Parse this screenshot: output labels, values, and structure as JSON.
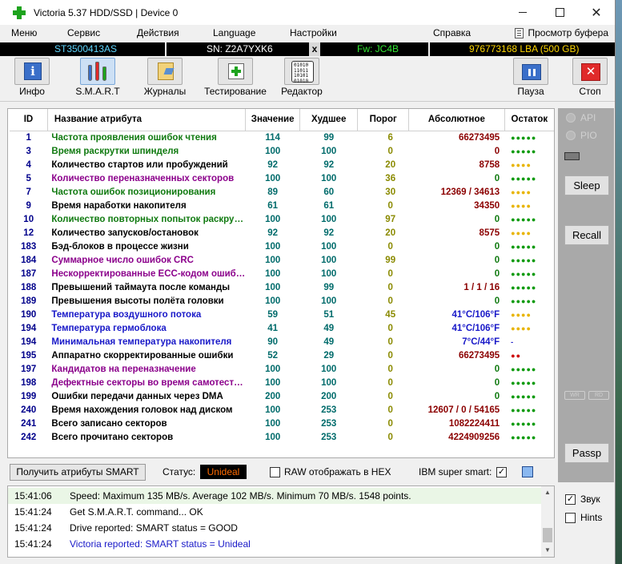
{
  "window": {
    "title": "Victoria 5.37 HDD/SSD | Device 0",
    "close_glyph": "✕"
  },
  "menu": {
    "items": [
      "Меню",
      "Сервис",
      "Действия",
      "Language",
      "Настройки",
      "Справка"
    ],
    "buffer_view": "Просмотр буфера"
  },
  "infobar": {
    "model": "ST3500413AS",
    "serial": "SN: Z2A7YXK6",
    "close_x": "x",
    "firmware": "Fw: JC4B",
    "capacity": "976773168 LBA (500 GB)"
  },
  "toolbar": {
    "info": "Инфо",
    "smart": "S.M.A.R.T",
    "logs": "Журналы",
    "testing": "Тестирование",
    "editor": "Редактор",
    "pause": "Пауза",
    "stop": "Стоп",
    "info_glyph": "i",
    "stop_glyph": "✕",
    "editor_glyph": "01010 11011 10101 01010"
  },
  "table": {
    "headers": {
      "id": "ID",
      "name": "Название атрибута",
      "value": "Значение",
      "worst": "Худшее",
      "threshold": "Порог",
      "absolute": "Абсолютное",
      "remaining": "Остаток"
    },
    "rows": [
      {
        "id": "1",
        "name": "Частота проявления ошибок чтения",
        "value": "114",
        "worst": "99",
        "threshold": "6",
        "absolute": "66273495",
        "remaining": "●●●●●",
        "name_color": "green",
        "rem_color": "green",
        "abs_color": "red"
      },
      {
        "id": "3",
        "name": "Время раскрутки шпинделя",
        "value": "100",
        "worst": "100",
        "threshold": "0",
        "absolute": "0",
        "remaining": "●●●●●",
        "name_color": "green",
        "rem_color": "green",
        "abs_color": "red"
      },
      {
        "id": "4",
        "name": "Количество стартов или пробуждений",
        "value": "92",
        "worst": "92",
        "threshold": "20",
        "absolute": "8758",
        "remaining": "●●●●",
        "name_color": "black",
        "rem_color": "yellow",
        "abs_color": "red"
      },
      {
        "id": "5",
        "name": "Количество переназначенных секторов",
        "value": "100",
        "worst": "100",
        "threshold": "36",
        "absolute": "0",
        "remaining": "●●●●●",
        "name_color": "purple",
        "rem_color": "green",
        "abs_color": "green"
      },
      {
        "id": "7",
        "name": "Частота ошибок позиционирования",
        "value": "89",
        "worst": "60",
        "threshold": "30",
        "absolute": "12369 / 34613",
        "remaining": "●●●●",
        "name_color": "green",
        "rem_color": "yellow",
        "abs_color": "red"
      },
      {
        "id": "9",
        "name": "Время наработки накопителя",
        "value": "61",
        "worst": "61",
        "threshold": "0",
        "absolute": "34350",
        "remaining": "●●●●",
        "name_color": "black",
        "rem_color": "yellow",
        "abs_color": "red"
      },
      {
        "id": "10",
        "name": "Количество повторных попыток раскрутки",
        "value": "100",
        "worst": "100",
        "threshold": "97",
        "absolute": "0",
        "remaining": "●●●●●",
        "name_color": "green",
        "rem_color": "green",
        "abs_color": "green"
      },
      {
        "id": "12",
        "name": "Количество запусков/остановок",
        "value": "92",
        "worst": "92",
        "threshold": "20",
        "absolute": "8575",
        "remaining": "●●●●",
        "name_color": "black",
        "rem_color": "yellow",
        "abs_color": "red"
      },
      {
        "id": "183",
        "name": "Бэд-блоков в процессе жизни",
        "value": "100",
        "worst": "100",
        "threshold": "0",
        "absolute": "0",
        "remaining": "●●●●●",
        "name_color": "black",
        "rem_color": "green",
        "abs_color": "green"
      },
      {
        "id": "184",
        "name": "Суммарное число ошибок CRC",
        "value": "100",
        "worst": "100",
        "threshold": "99",
        "absolute": "0",
        "remaining": "●●●●●",
        "name_color": "purple",
        "rem_color": "green",
        "abs_color": "green"
      },
      {
        "id": "187",
        "name": "Нескорректированные ECC-кодом ошибки",
        "value": "100",
        "worst": "100",
        "threshold": "0",
        "absolute": "0",
        "remaining": "●●●●●",
        "name_color": "purple",
        "rem_color": "green",
        "abs_color": "green"
      },
      {
        "id": "188",
        "name": "Превышений таймаута после команды",
        "value": "100",
        "worst": "99",
        "threshold": "0",
        "absolute": "1 / 1 / 16",
        "remaining": "●●●●●",
        "name_color": "black",
        "rem_color": "green",
        "abs_color": "red"
      },
      {
        "id": "189",
        "name": "Превышения высоты полёта головки",
        "value": "100",
        "worst": "100",
        "threshold": "0",
        "absolute": "0",
        "remaining": "●●●●●",
        "name_color": "black",
        "rem_color": "green",
        "abs_color": "green"
      },
      {
        "id": "190",
        "name": "Температура воздушного потока",
        "value": "59",
        "worst": "51",
        "threshold": "45",
        "absolute": "41°C/106°F",
        "remaining": "●●●●",
        "name_color": "blue",
        "rem_color": "yellow",
        "abs_color": "blue"
      },
      {
        "id": "194",
        "name": "Температура гермоблока",
        "value": "41",
        "worst": "49",
        "threshold": "0",
        "absolute": "41°C/106°F",
        "remaining": "●●●●",
        "name_color": "blue",
        "rem_color": "yellow",
        "abs_color": "blue"
      },
      {
        "id": "194",
        "name": "Минимальная температура накопителя",
        "value": "90",
        "worst": "49",
        "threshold": "0",
        "absolute": "7°C/44°F",
        "remaining": "-",
        "name_color": "blue",
        "rem_color": "blue",
        "abs_color": "blue"
      },
      {
        "id": "195",
        "name": "Аппаратно скорректированные ошибки",
        "value": "52",
        "worst": "29",
        "threshold": "0",
        "absolute": "66273495",
        "remaining": "●●",
        "name_color": "black",
        "rem_color": "red",
        "abs_color": "red"
      },
      {
        "id": "197",
        "name": "Кандидатов на переназначение",
        "value": "100",
        "worst": "100",
        "threshold": "0",
        "absolute": "0",
        "remaining": "●●●●●",
        "name_color": "purple",
        "rem_color": "green",
        "abs_color": "green"
      },
      {
        "id": "198",
        "name": "Дефектные секторы во время самотестирования",
        "value": "100",
        "worst": "100",
        "threshold": "0",
        "absolute": "0",
        "remaining": "●●●●●",
        "name_color": "purple",
        "rem_color": "green",
        "abs_color": "green"
      },
      {
        "id": "199",
        "name": "Ошибки передачи данных через DMA",
        "value": "200",
        "worst": "200",
        "threshold": "0",
        "absolute": "0",
        "remaining": "●●●●●",
        "name_color": "black",
        "rem_color": "green",
        "abs_color": "green"
      },
      {
        "id": "240",
        "name": "Время нахождения головок над диском",
        "value": "100",
        "worst": "253",
        "threshold": "0",
        "absolute": "12607 / 0 / 54165",
        "remaining": "●●●●●",
        "name_color": "black",
        "rem_color": "green",
        "abs_color": "red"
      },
      {
        "id": "241",
        "name": "Всего записано секторов",
        "value": "100",
        "worst": "253",
        "threshold": "0",
        "absolute": "1082224411",
        "remaining": "●●●●●",
        "name_color": "black",
        "rem_color": "green",
        "abs_color": "red"
      },
      {
        "id": "242",
        "name": "Всего прочитано секторов",
        "value": "100",
        "worst": "253",
        "threshold": "0",
        "absolute": "4224909256",
        "remaining": "●●●●●",
        "name_color": "black",
        "rem_color": "green",
        "abs_color": "red"
      }
    ]
  },
  "status_bar": {
    "get_attributes": "Получить атрибуты SMART",
    "status_label": "Статус:",
    "status_value": "Unideal",
    "raw_hex": "RAW отображать в HEX",
    "ibm": "IBM super smart:",
    "ibm_checked": "✓"
  },
  "log": {
    "entries": [
      {
        "time": "15:41:06",
        "message": "Speed: Maximum 135 MB/s. Average 102 MB/s. Minimum 70 MB/s. 1548 points."
      },
      {
        "time": "15:41:24",
        "message": "Get S.M.A.R.T. command... OK"
      },
      {
        "time": "15:41:24",
        "message": "Drive reported: SMART status = GOOD"
      },
      {
        "time": "15:41:24",
        "message": "Victoria reported: SMART status = Unideal"
      }
    ],
    "scroll_up": "▲",
    "scroll_down": "▼"
  },
  "right_panel": {
    "api": "API",
    "pio": "PIO",
    "sleep": "Sleep",
    "recall": "Recall",
    "wr": "WR",
    "rd": "RD",
    "passp": "Passp",
    "sound": "Звук",
    "sound_checked": "✓",
    "hints": "Hints"
  },
  "colors": {
    "green": "#107a10",
    "purple": "#8b008b",
    "blue": "#1818c8",
    "dark_red": "#8b0000",
    "status_orange": "#ff6a00",
    "info_cyan": "#5fd7ff",
    "info_green": "#32e832",
    "info_yellow": "#ffd700"
  }
}
